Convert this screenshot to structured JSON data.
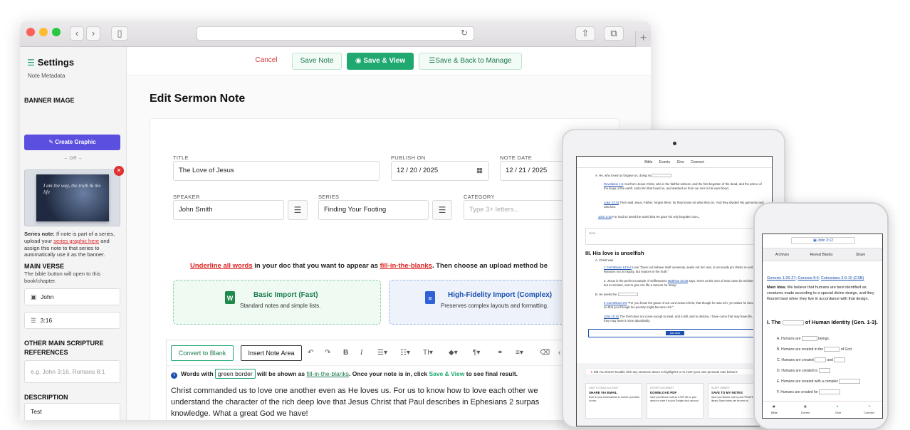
{
  "browser": {
    "reload_glyph": "↻"
  },
  "sidebar": {
    "title": "Settings",
    "subtitle": "Note Metadata",
    "banner_heading": "BANNER IMAGE",
    "create_label": "Create Graphic",
    "or": "– OR –",
    "banner_text": "I am the way, the truth & the life",
    "series_note_lead": "Series note:",
    "series_note_a": " If note is part of a series, upload your ",
    "series_note_link": "series graphic here",
    "series_note_b": " and assign this note to that series to automatically use it as the banner.",
    "main_verse_heading": "MAIN VERSE",
    "main_verse_help": "The bible button will open to this book/chapter.",
    "book": "John",
    "chapter_verse": "3:16",
    "other_heading": "OTHER MAIN SCRIPTURE REFERENCES",
    "other_placeholder": "e.g. John 3:16, Romans 8:1",
    "description_heading": "DESCRIPTION",
    "description_value": "Test"
  },
  "toolbar": {
    "cancel": "Cancel",
    "save": "Save Note",
    "save_view": "Save & View",
    "save_back": "Save & Back to Manage"
  },
  "page_title": "Edit Sermon Note",
  "form": {
    "title_label": "TITLE",
    "title_value": "The Love of Jesus",
    "publish_label": "PUBLISH ON",
    "publish_value": "12 / 20 / 2025",
    "notedate_label": "NOTE DATE",
    "notedate_value": "12 / 21 / 2025",
    "speaker_label": "SPEAKER",
    "speaker_value": "John Smith",
    "series_label": "SERIES",
    "series_value": "Finding Your Footing",
    "category_label": "CATEGORY",
    "category_placeholder": "Type 3+ letters..."
  },
  "instructions": {
    "u1": "Underline all words",
    "t1": " in your doc that you want to appear as ",
    "u2": "fill-in-the-blanks",
    "t2": ". Then choose an upload method be"
  },
  "imports": {
    "basic_title": "Basic Import (Fast)",
    "basic_desc": "Standard notes and simple lists.",
    "hifi_title": "High-Fidelity Import (Complex)",
    "hifi_desc": "Preserves complex layouts and formatting."
  },
  "editor": {
    "convert": "Convert to Blank",
    "insert": "Insert Note Area",
    "info_a": "Words with ",
    "info_box": "green border",
    "info_b": " will be shown as ",
    "info_link": "fill-in-the-blanks",
    "info_c": ". Once your note is in, click ",
    "info_g": "Save & View",
    "info_d": " to see final result.",
    "body": "Christ commanded us to love one another even as He loves us. For us to know how to love each other we understand the character of the rich deep love that Jesus Christ that Paul describes in Ephesians 2 surpas knowledge. What a great God we have!"
  },
  "tablet": {
    "nav": [
      "Bible",
      "Events",
      "Give",
      "Connect"
    ],
    "a_line": "A. He, who loved us forgave us, doing so",
    "p1_ref": "Revelation 1:5",
    "p1": " And from Jesus Christ, who is the faithful witness, and the first begotten of the dead, and the prince of the kings of the earth. Unto him that loved us, and washed us from our sins in his own blood,",
    "p2_ref": "Luke 23:34",
    "p2": " Then said Jesus, Father, forgive them; for they know not what they do.' And they divided His garments and cast lots.",
    "b_line_ref": "John 3:16",
    "b_line": " For God so loved the world that He gave his only begotten Son...",
    "note_ph": "Note...",
    "heading": "III. His love is unselfish",
    "c1": "A. Christ was",
    "c1_ref": "1 Corinthians 13:5-6",
    "c1_txt": " Love \"Does not behave itself unseemly, seeks not her own, is not easily pro thinks no evil; Rejoices not in iniquity, but rejoices in the truth.\"",
    "c2": "2. Jesus is the perfect example of selflessness ",
    "c2_ref": "Matthew 20:28",
    "c2_txt": " says, 'Even as the Son of man came be ministered unto, but to minister, and to give His life a ransom for many.'",
    "d1": "B. He seeks the",
    "d1_ref": "2 Corinthians 8:9",
    "d1_txt": " \"For you know the grace of our Lord Jesus Christ, that though he was rich, yet sakes he became poor, so that you through his poverty might become rich.\"",
    "d2_ref": "John 10:10",
    "d2_txt": " The thief does not come except to steal, and to kill, and to destroy. I have come that may have life, and that they may have it more abundantly.",
    "add_note": "Add Note",
    "did_you_know": "Did You Know? Double click any sentence above to highlight it or to insert your own personal note below it.",
    "cards": [
      {
        "kicker": "SAVE TO EMAIL ACCOUNT",
        "title": "SHARE VIA EMAIL",
        "desc": "Enter in your email address to receive your filled-in note."
      },
      {
        "kicker": "EXPORT DOCUMENT",
        "title": "DOWNLOAD PDF",
        "desc": "Save your filled-in note as a PDF file on your device or save it to your Google cloud account."
      },
      {
        "kicker": "IN-APP LIBRARY",
        "title": "SAVE TO MY NOTES",
        "desc": "Save your filled-in note to your PRIVATE NOTES library. Saved notes can be seen or..."
      }
    ]
  },
  "phone": {
    "verse": "John 3:12",
    "tabs": [
      "Archives",
      "Reveal Blanks",
      "Share"
    ],
    "refs": [
      "Genesis 1:26-27",
      "Genesis 9:6",
      "Colossians 3:9-10 (CSB)"
    ],
    "main_idea_lead": "Main Idea:",
    "main_idea": " We believe that humans are best identified as creatures made according to a special divine design, and they flourish best when they live in accordance with that design.",
    "heading_a": "I. The",
    "heading_b": "of Human Identity (Gen. 1-3).",
    "items": [
      {
        "a": "A. Humans are",
        "b": "beings."
      },
      {
        "a": "B. Humans are created in the",
        "b": "of God."
      },
      {
        "a": "C. Humans are created",
        "b": "and"
      },
      {
        "a": "D. Humans are created to",
        "b": ""
      },
      {
        "a": "E. Humans are created with a complex",
        "b": ""
      },
      {
        "a": "F. Humans are created for",
        "b": ""
      }
    ],
    "bottom_nav": [
      "Bible",
      "Events",
      "Give",
      "Connect"
    ]
  }
}
